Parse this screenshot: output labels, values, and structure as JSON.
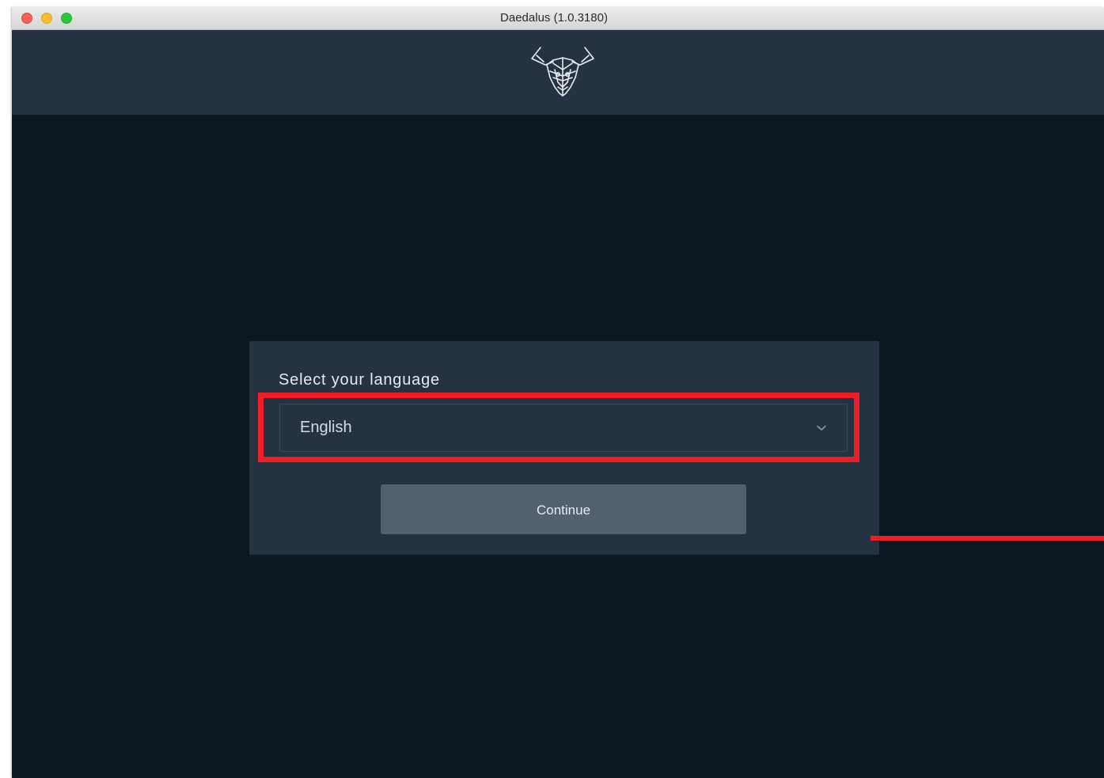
{
  "window": {
    "title": "Daedalus (1.0.3180)"
  },
  "header": {
    "logo": "daedalus-bull-logo-icon"
  },
  "language_screen": {
    "label": "Select your language",
    "selected_language": "English",
    "continue_label": "Continue"
  },
  "annotation": {
    "highlight_color": "#f01d25"
  },
  "colors": {
    "background": "#0b1822",
    "header": "#243242",
    "card": "#243242",
    "button": "#536070"
  }
}
